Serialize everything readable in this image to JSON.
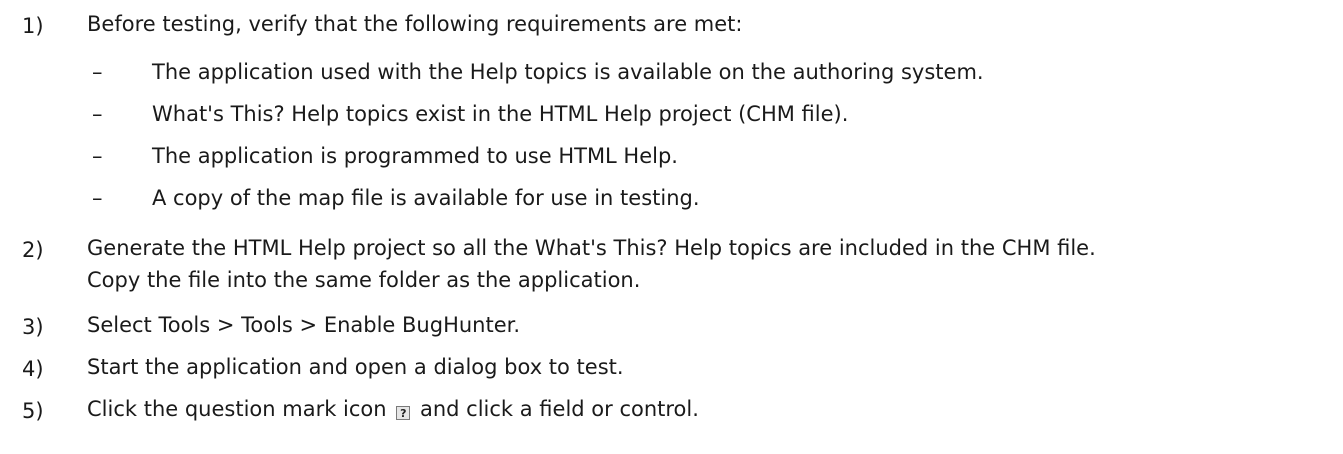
{
  "steps": [
    {
      "number": "1)",
      "text": "Before testing, verify that the following requirements are met:",
      "subitems": [
        {
          "dash": "–",
          "text": "The application used with the Help topics is available on the authoring system."
        },
        {
          "dash": "–",
          "text": "What's This? Help topics exist in the HTML Help project (CHM file)."
        },
        {
          "dash": "–",
          "text": "The application is programmed to use HTML Help."
        },
        {
          "dash": "–",
          "text": "A copy of the map file is available for use in testing."
        }
      ]
    },
    {
      "number": "2)",
      "line1": "Generate the HTML Help project so all the What's This? Help topics are included in the CHM file.",
      "line2": "Copy the file into the same folder as the application."
    },
    {
      "number": "3)",
      "text": "Select Tools > Tools > Enable BugHunter."
    },
    {
      "number": "4)",
      "text": "Start the application and open a dialog box to test."
    },
    {
      "number": "5)",
      "text_before": "Click the question mark icon",
      "icon": "question-mark-icon",
      "icon_glyph": "?",
      "text_after": "and click a field or control."
    }
  ]
}
